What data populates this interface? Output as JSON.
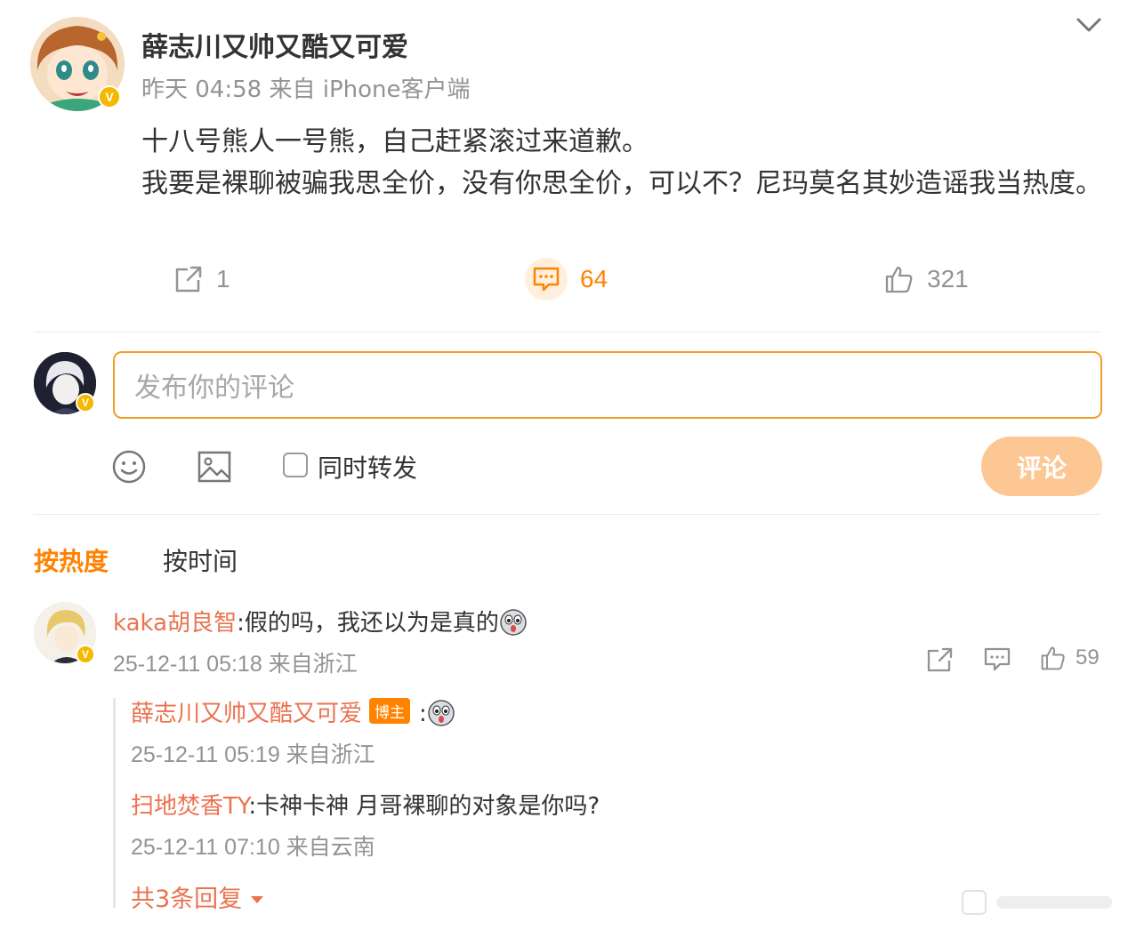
{
  "post": {
    "author": "薛志川又帅又酷又可爱",
    "time": "昨天 04:58",
    "source": "来自 iPhone客户端",
    "content_lines": [
      "十八号熊人一号熊，自己赶紧滚过来道歉。",
      "我要是裸聊被骗我思全价，没有你思全价，可以不？尼玛莫名其妙造谣我当热度。"
    ],
    "repost_count": "1",
    "comment_count": "64",
    "like_count": "321"
  },
  "compose": {
    "placeholder": "发布你的评论",
    "also_repost_label": "同时转发",
    "submit_label": "评论"
  },
  "sort": {
    "hot_label": "按热度",
    "time_label": "按时间"
  },
  "comments": [
    {
      "author": "kaka胡良智",
      "text": ":假的吗，我还以为是真的",
      "meta": "25-12-11 05:18 来自浙江",
      "likes": "59",
      "replies": [
        {
          "author": "薛志川又帅又酷又可爱",
          "tag": "博主",
          "text": ":",
          "meta": "25-12-11 05:19 来自浙江"
        },
        {
          "author": "扫地焚香TY",
          "text": ":卡神卡神 月哥裸聊的对象是你吗?",
          "meta": "25-12-11 07:10 来自云南"
        }
      ],
      "more_replies_label": "共3条回复"
    }
  ],
  "colors": {
    "accent": "#ff8200",
    "name_link": "#eb7350",
    "muted": "#939393",
    "submit_disabled": "#fcc793",
    "input_border": "#f39d2a"
  },
  "icons": [
    "chevron-down-icon",
    "repost-icon",
    "comment-icon",
    "like-icon",
    "emoji-icon",
    "image-icon",
    "verified-icon",
    "dropdown-caret-icon"
  ]
}
